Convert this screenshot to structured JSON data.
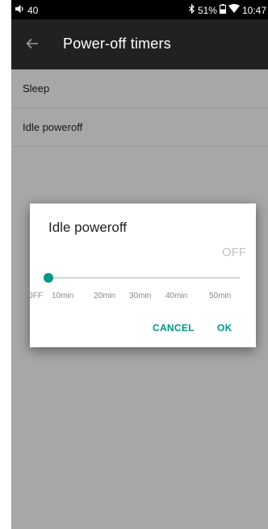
{
  "statusbar": {
    "volume": "40",
    "battery": "51%",
    "time": "10:47"
  },
  "toolbar": {
    "title": "Power-off timers"
  },
  "list": {
    "items": [
      {
        "label": "Sleep"
      },
      {
        "label": "Idle poweroff"
      }
    ]
  },
  "dialog": {
    "title": "Idle poweroff",
    "value": "OFF",
    "slider_position": 0,
    "ticks": [
      "OFF",
      "10min",
      "20min",
      "30min",
      "40min",
      "50min"
    ],
    "cancel_label": "CANCEL",
    "ok_label": "OK"
  },
  "colors": {
    "accent": "#009688",
    "toolbar": "#212121",
    "statusbar": "#000000"
  },
  "icons": [
    "volume-icon",
    "bluetooth-icon",
    "battery-icon",
    "wifi-icon",
    "back-arrow-icon"
  ]
}
